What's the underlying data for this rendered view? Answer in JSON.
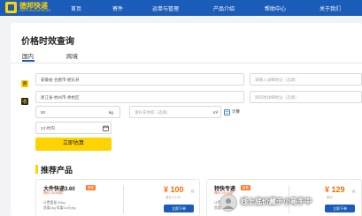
{
  "header": {
    "brand": {
      "name": "德邦快递",
      "tagline": "DEPPON EXPRESS"
    },
    "nav": [
      {
        "label": "首页"
      },
      {
        "label": "寄件"
      },
      {
        "label": "运单与管理"
      },
      {
        "label": "产品介绍"
      },
      {
        "label": "帮助中心"
      },
      {
        "label": "关于我们"
      }
    ],
    "colors": {
      "bar": "#1a5cb8",
      "accent": "#ffd300"
    }
  },
  "page": {
    "title": "价格时效查询",
    "tabs": [
      {
        "label": "国内",
        "active": true
      },
      {
        "label": "跨境",
        "active": false
      }
    ]
  },
  "form": {
    "origin": {
      "value": "安徽省-合肥市-肥东县",
      "placeholder": "请输入详细地址（选填）"
    },
    "destination": {
      "value": "浙江省-杭州市-余杭区",
      "placeholder": "目的地详细地址（选填）"
    },
    "weight": {
      "value": "50",
      "unit": "kg"
    },
    "volume": {
      "placeholder": "请补充体积（选填）",
      "unit": "m³",
      "calc_label": "计算"
    },
    "pickup_time": {
      "value": "2小时内"
    },
    "submit_label": "立即估算"
  },
  "recommend": {
    "title": "推荐产品",
    "products": [
      {
        "name": "大件快递3.60",
        "badge": "推荐",
        "subtitle": "预计 20:00前",
        "lines": [
          "计费重量 50kg",
          "首重1kg 续重3.6元/kg"
        ],
        "price": "¥ 100",
        "price_suffix": "起",
        "orig_price": "原价 ¥ 129",
        "order_label": "立即下单"
      },
      {
        "name": "特快专递",
        "badge": "推荐",
        "subtitle": "预计 20:00前",
        "lines": [
          "计费重量 50kg",
          "首重1kg"
        ],
        "price": "¥ 129",
        "price_suffix": "起",
        "orig_price": "原价",
        "order_label": "立即下单"
      }
    ]
  },
  "watermark": {
    "text": "线上底价藏于小哥手中"
  }
}
